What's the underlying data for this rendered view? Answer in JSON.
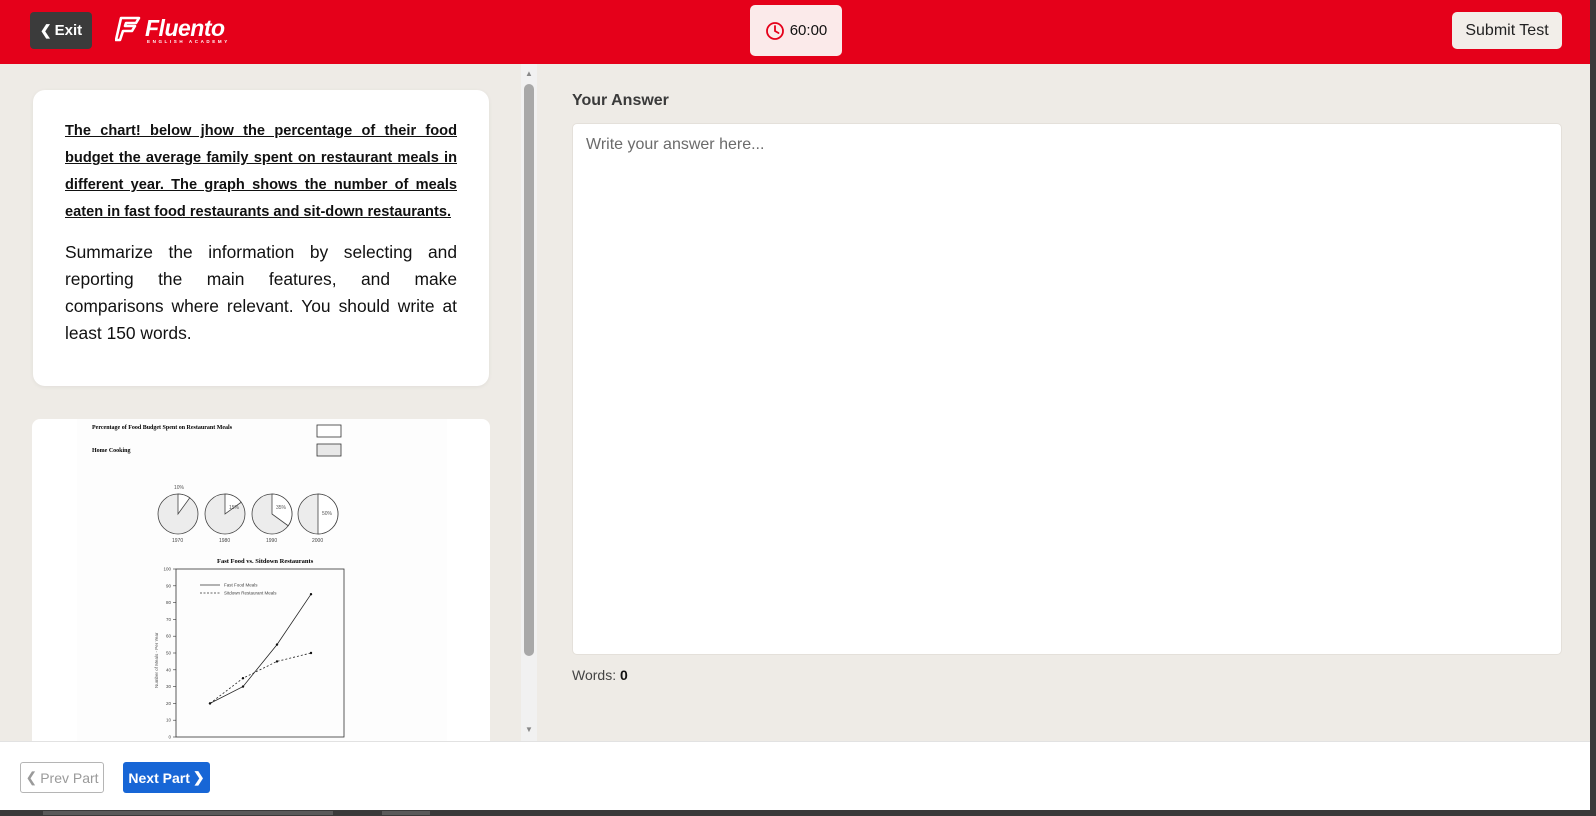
{
  "header": {
    "exit_label": "Exit",
    "logo_name": "Fluento",
    "logo_tagline": "ENGLISH ACADEMY",
    "timer": "60:00",
    "submit_label": "Submit Test",
    "brand_color": "#e5001a"
  },
  "prompt": {
    "intro": "The chart! below jhow the percentage of their food budget the average family spent on restaurant meals in different year. The graph shows the number of meals eaten in fast food restaurants and sit-down restaurants.",
    "instruction": "Summarize the information by selecting and reporting the main features, and make comparisons where relevant. You should write at least 150 words."
  },
  "figure": {
    "pie_title": "Percentage of Food Budget Spent on Restaurant Meals",
    "legend_home": "Home Cooking",
    "pies": [
      {
        "year": "1970",
        "label": "10%",
        "value": 10
      },
      {
        "year": "1980",
        "label": "15%",
        "value": 15
      },
      {
        "year": "1990",
        "label": "35%",
        "value": 35
      },
      {
        "year": "2000",
        "label": "50%",
        "value": 50
      }
    ],
    "line_title": "Fast Food vs. Sitdown Restaurants",
    "ylabel": "Number of Meals - Per Year",
    "y_ticks": [
      "0",
      "10",
      "20",
      "30",
      "40",
      "50",
      "60",
      "70",
      "80",
      "90",
      "100"
    ],
    "series": [
      {
        "name": "Fast Food Meals",
        "values": [
          20,
          30,
          55,
          85
        ]
      },
      {
        "name": "Sitdown Restaurant Meals",
        "values": [
          20,
          35,
          45,
          50
        ]
      }
    ]
  },
  "answer": {
    "label": "Your Answer",
    "placeholder": "Write your answer here...",
    "value": "",
    "words_label": "Words:",
    "words_count": "0"
  },
  "footer": {
    "prev_label": "Prev Part",
    "next_label": "Next Part",
    "accent": "#1766d6"
  }
}
